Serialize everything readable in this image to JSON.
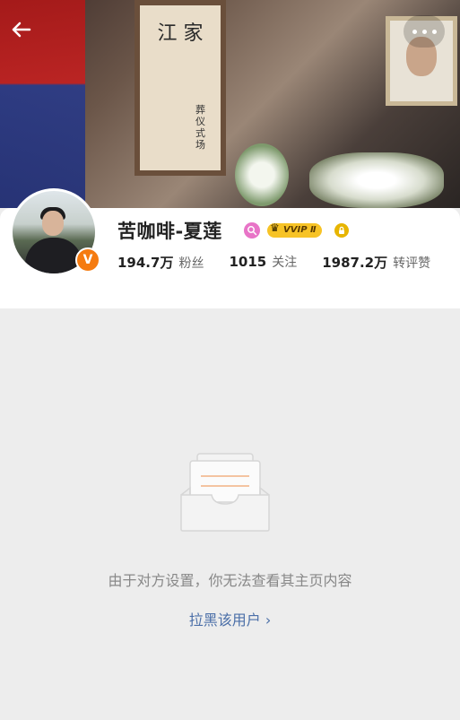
{
  "cover": {
    "plaque_title": "江 家",
    "plaque_sub": "葬仪式场"
  },
  "navigation": {
    "back_icon": "arrow-left-icon",
    "more_icon": "more-dots-icon"
  },
  "profile": {
    "username": "苦咖啡-夏莲",
    "verified_badge": "V",
    "vvip_label": "VVIP Ⅱ",
    "stats": [
      {
        "num": "194.7万",
        "label": "粉丝"
      },
      {
        "num": "1015",
        "label": "关注"
      },
      {
        "num": "1987.2万",
        "label": "转评赞"
      }
    ]
  },
  "empty_state": {
    "message": "由于对方设置，你无法查看其主页内容",
    "block_link": "拉黑该用户 ›"
  },
  "colors": {
    "accent_orange": "#f57b10",
    "link_blue": "#4b6fa8",
    "vvip_gold": "#f7c326"
  }
}
